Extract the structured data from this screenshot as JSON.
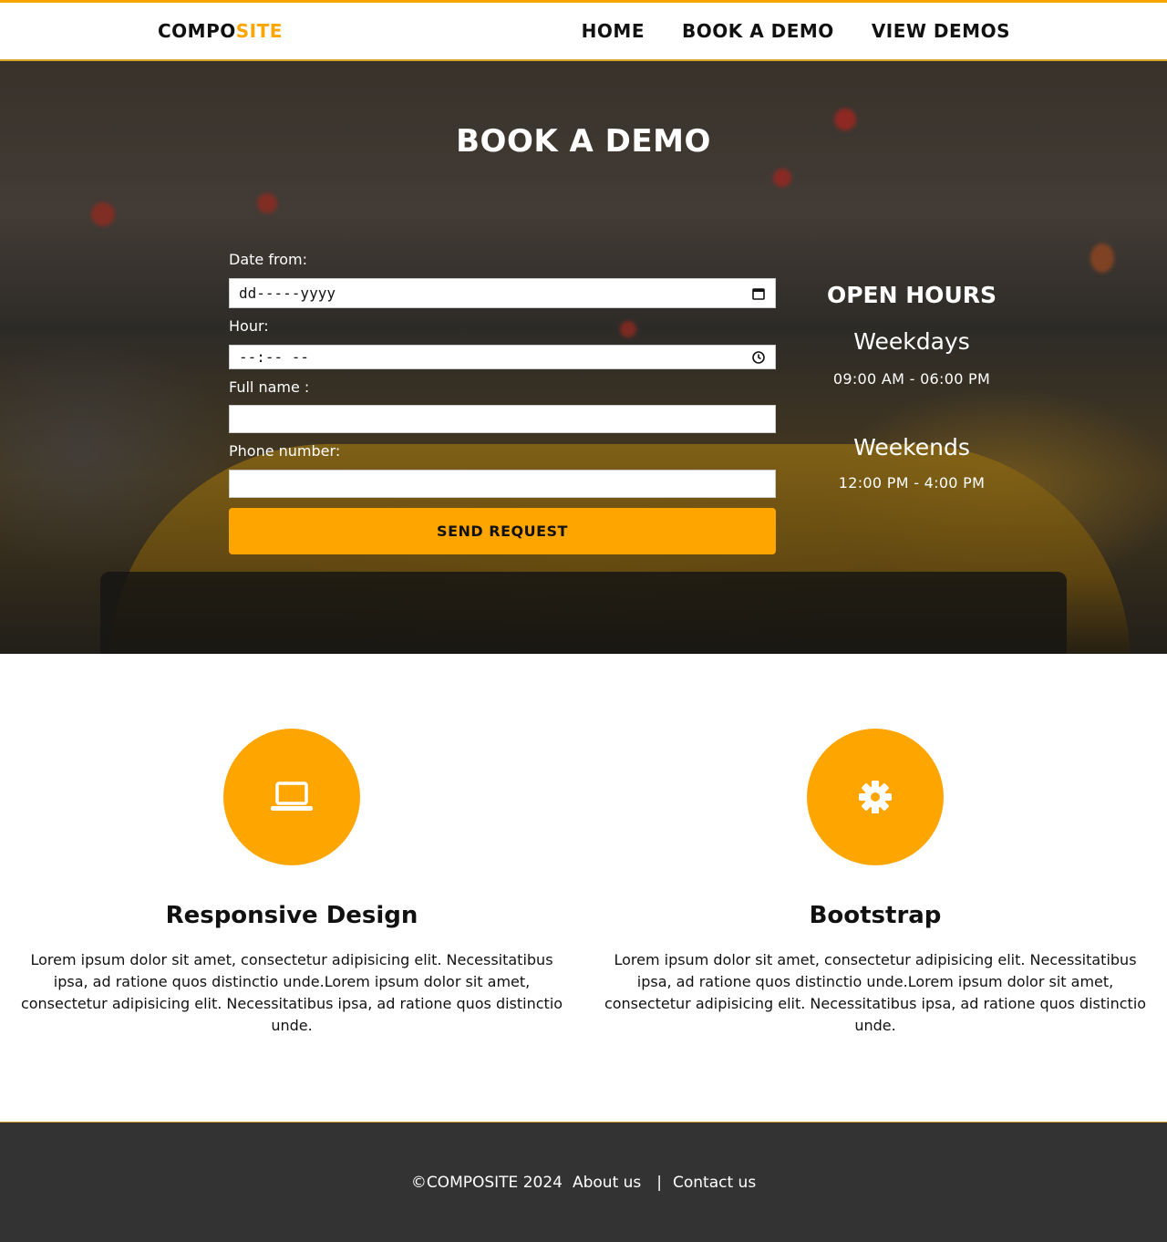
{
  "header": {
    "logo_part1": "COMPO",
    "logo_part2": "SITE",
    "nav": [
      "HOME",
      "BOOK A DEMO",
      "VIEW DEMOS"
    ]
  },
  "hero": {
    "title": "BOOK A DEMO"
  },
  "form": {
    "date_label": "Date from:",
    "date_value": "dd-----yyyy",
    "hour_label": "Hour:",
    "hour_value": "--:-- --",
    "name_label": "Full name :",
    "name_value": "",
    "phone_label": "Phone number:",
    "phone_value": "",
    "submit_label": "SEND REQUEST"
  },
  "open_hours": {
    "title": "OPEN HOURS",
    "weekdays_label": "Weekdays",
    "weekdays_time": "09:00 AM - 06:00 PM",
    "weekends_label": "Weekends",
    "weekends_time": "12:00 PM - 4:00 PM"
  },
  "features": [
    {
      "icon": "laptop-icon",
      "title": "Responsive Design",
      "text": "Lorem ipsum dolor sit amet, consectetur adipisicing elit. Necessitatibus ipsa, ad ratione quos distinctio unde.Lorem ipsum dolor sit amet, consectetur adipisicing elit. Necessitatibus ipsa, ad ratione quos distinctio unde."
    },
    {
      "icon": "gear-icon",
      "title": "Bootstrap",
      "text": "Lorem ipsum dolor sit amet, consectetur adipisicing elit. Necessitatibus ipsa, ad ratione quos distinctio unde.Lorem ipsum dolor sit amet, consectetur adipisicing elit. Necessitatibus ipsa, ad ratione quos distinctio unde."
    }
  ],
  "footer": {
    "copyright": "©COMPOSITE 2024",
    "about": "About us",
    "separator": "|",
    "contact": "Contact us"
  },
  "colors": {
    "accent": "#ffa500",
    "footer_bg": "#333333"
  }
}
